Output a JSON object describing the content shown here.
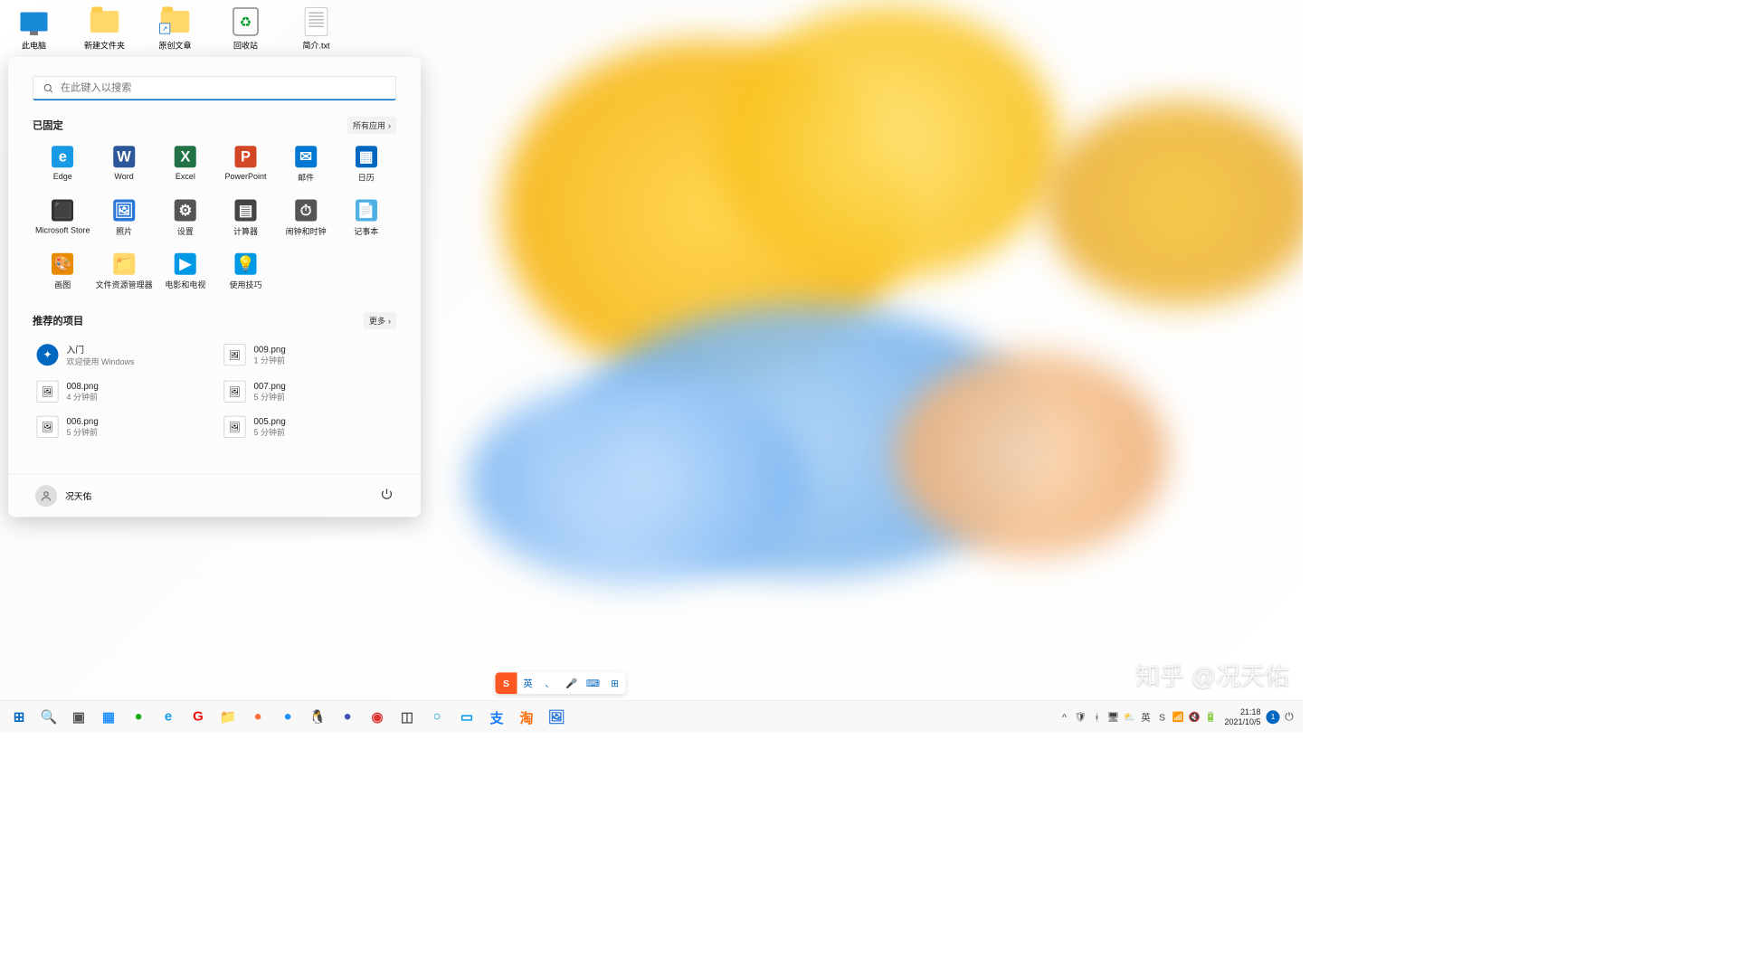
{
  "desktop_icons": [
    {
      "name": "this-pc",
      "label": "此电脑",
      "icon": "monitor"
    },
    {
      "name": "new-folder",
      "label": "新建文件夹",
      "icon": "folder"
    },
    {
      "name": "original-articles",
      "label": "原创文章",
      "icon": "folder-shortcut"
    },
    {
      "name": "recycle-bin",
      "label": "回收站",
      "icon": "recycle"
    },
    {
      "name": "intro-txt",
      "label": "简介.txt",
      "icon": "txt"
    }
  ],
  "start": {
    "search_placeholder": "在此键入以搜索",
    "pinned_header": "已固定",
    "all_apps": "所有应用",
    "recommended_header": "推荐的项目",
    "more": "更多",
    "user": "况天佑",
    "pinned": [
      {
        "label": "Edge",
        "color": "#169ae6",
        "g": "e"
      },
      {
        "label": "Word",
        "color": "#2b579a",
        "g": "W"
      },
      {
        "label": "Excel",
        "color": "#217346",
        "g": "X"
      },
      {
        "label": "PowerPoint",
        "color": "#d24726",
        "g": "P"
      },
      {
        "label": "邮件",
        "color": "#0078d4",
        "g": "✉"
      },
      {
        "label": "日历",
        "color": "#0067c0",
        "g": "▦"
      },
      {
        "label": "Microsoft Store",
        "color": "#333",
        "g": "⬛"
      },
      {
        "label": "照片",
        "color": "#2975d9",
        "g": "🖼"
      },
      {
        "label": "设置",
        "color": "#555",
        "g": "⚙"
      },
      {
        "label": "计算器",
        "color": "#444",
        "g": "▤"
      },
      {
        "label": "闹钟和时钟",
        "color": "#555",
        "g": "⏱"
      },
      {
        "label": "记事本",
        "color": "#4fb0e3",
        "g": "📄"
      },
      {
        "label": "画图",
        "color": "#e88b00",
        "g": "🎨"
      },
      {
        "label": "文件资源管理器",
        "color": "#ffd76b",
        "g": "📁"
      },
      {
        "label": "电影和电视",
        "color": "#0099e5",
        "g": "▶"
      },
      {
        "label": "使用技巧",
        "color": "#0099e5",
        "g": "💡"
      }
    ],
    "recommended": [
      {
        "title": "入门",
        "sub": "欢迎使用 Windows",
        "icon": "welcome"
      },
      {
        "title": "009.png",
        "sub": "1 分钟前",
        "icon": "img"
      },
      {
        "title": "008.png",
        "sub": "4 分钟前",
        "icon": "img"
      },
      {
        "title": "007.png",
        "sub": "5 分钟前",
        "icon": "img"
      },
      {
        "title": "006.png",
        "sub": "5 分钟前",
        "icon": "img"
      },
      {
        "title": "005.png",
        "sub": "5 分钟前",
        "icon": "img"
      }
    ]
  },
  "ime": {
    "items": [
      "S",
      "英",
      "、",
      "🎤",
      "⌨",
      "⊞"
    ]
  },
  "watermark": "知乎 @况天佑",
  "taskbar": {
    "apps": [
      {
        "n": "start",
        "g": "⊞",
        "c": "#0067c0"
      },
      {
        "n": "search",
        "g": "🔍",
        "c": "#333"
      },
      {
        "n": "taskview",
        "g": "▣",
        "c": "#555"
      },
      {
        "n": "widgets",
        "g": "▦",
        "c": "#1e90ff"
      },
      {
        "n": "wechat",
        "g": "●",
        "c": "#1aad19"
      },
      {
        "n": "edge",
        "g": "e",
        "c": "#169ae6"
      },
      {
        "n": "garena",
        "g": "G",
        "c": "#e11"
      },
      {
        "n": "explorer",
        "g": "📁",
        "c": "#ffb02e"
      },
      {
        "n": "firefox",
        "g": "●",
        "c": "#ff7139"
      },
      {
        "n": "thunder",
        "g": "●",
        "c": "#1e90ff"
      },
      {
        "n": "qq",
        "g": "🐧",
        "c": "#000"
      },
      {
        "n": "app1",
        "g": "●",
        "c": "#4050b5"
      },
      {
        "n": "netease",
        "g": "◉",
        "c": "#d33"
      },
      {
        "n": "app2",
        "g": "◫",
        "c": "#555"
      },
      {
        "n": "cortana",
        "g": "○",
        "c": "#0099e5"
      },
      {
        "n": "app3",
        "g": "▭",
        "c": "#0099e5"
      },
      {
        "n": "alipay",
        "g": "支",
        "c": "#1677ff"
      },
      {
        "n": "taobao",
        "g": "淘",
        "c": "#ff6a00"
      },
      {
        "n": "photos",
        "g": "🖼",
        "c": "#2975d9"
      }
    ],
    "tray": [
      "^",
      "🛡",
      "ᚼ",
      "🖥",
      "⛅",
      "英",
      "S",
      "📶",
      "🔇",
      "🔋"
    ],
    "time": "21:18",
    "date": "2021/10/5",
    "notif": "1"
  }
}
